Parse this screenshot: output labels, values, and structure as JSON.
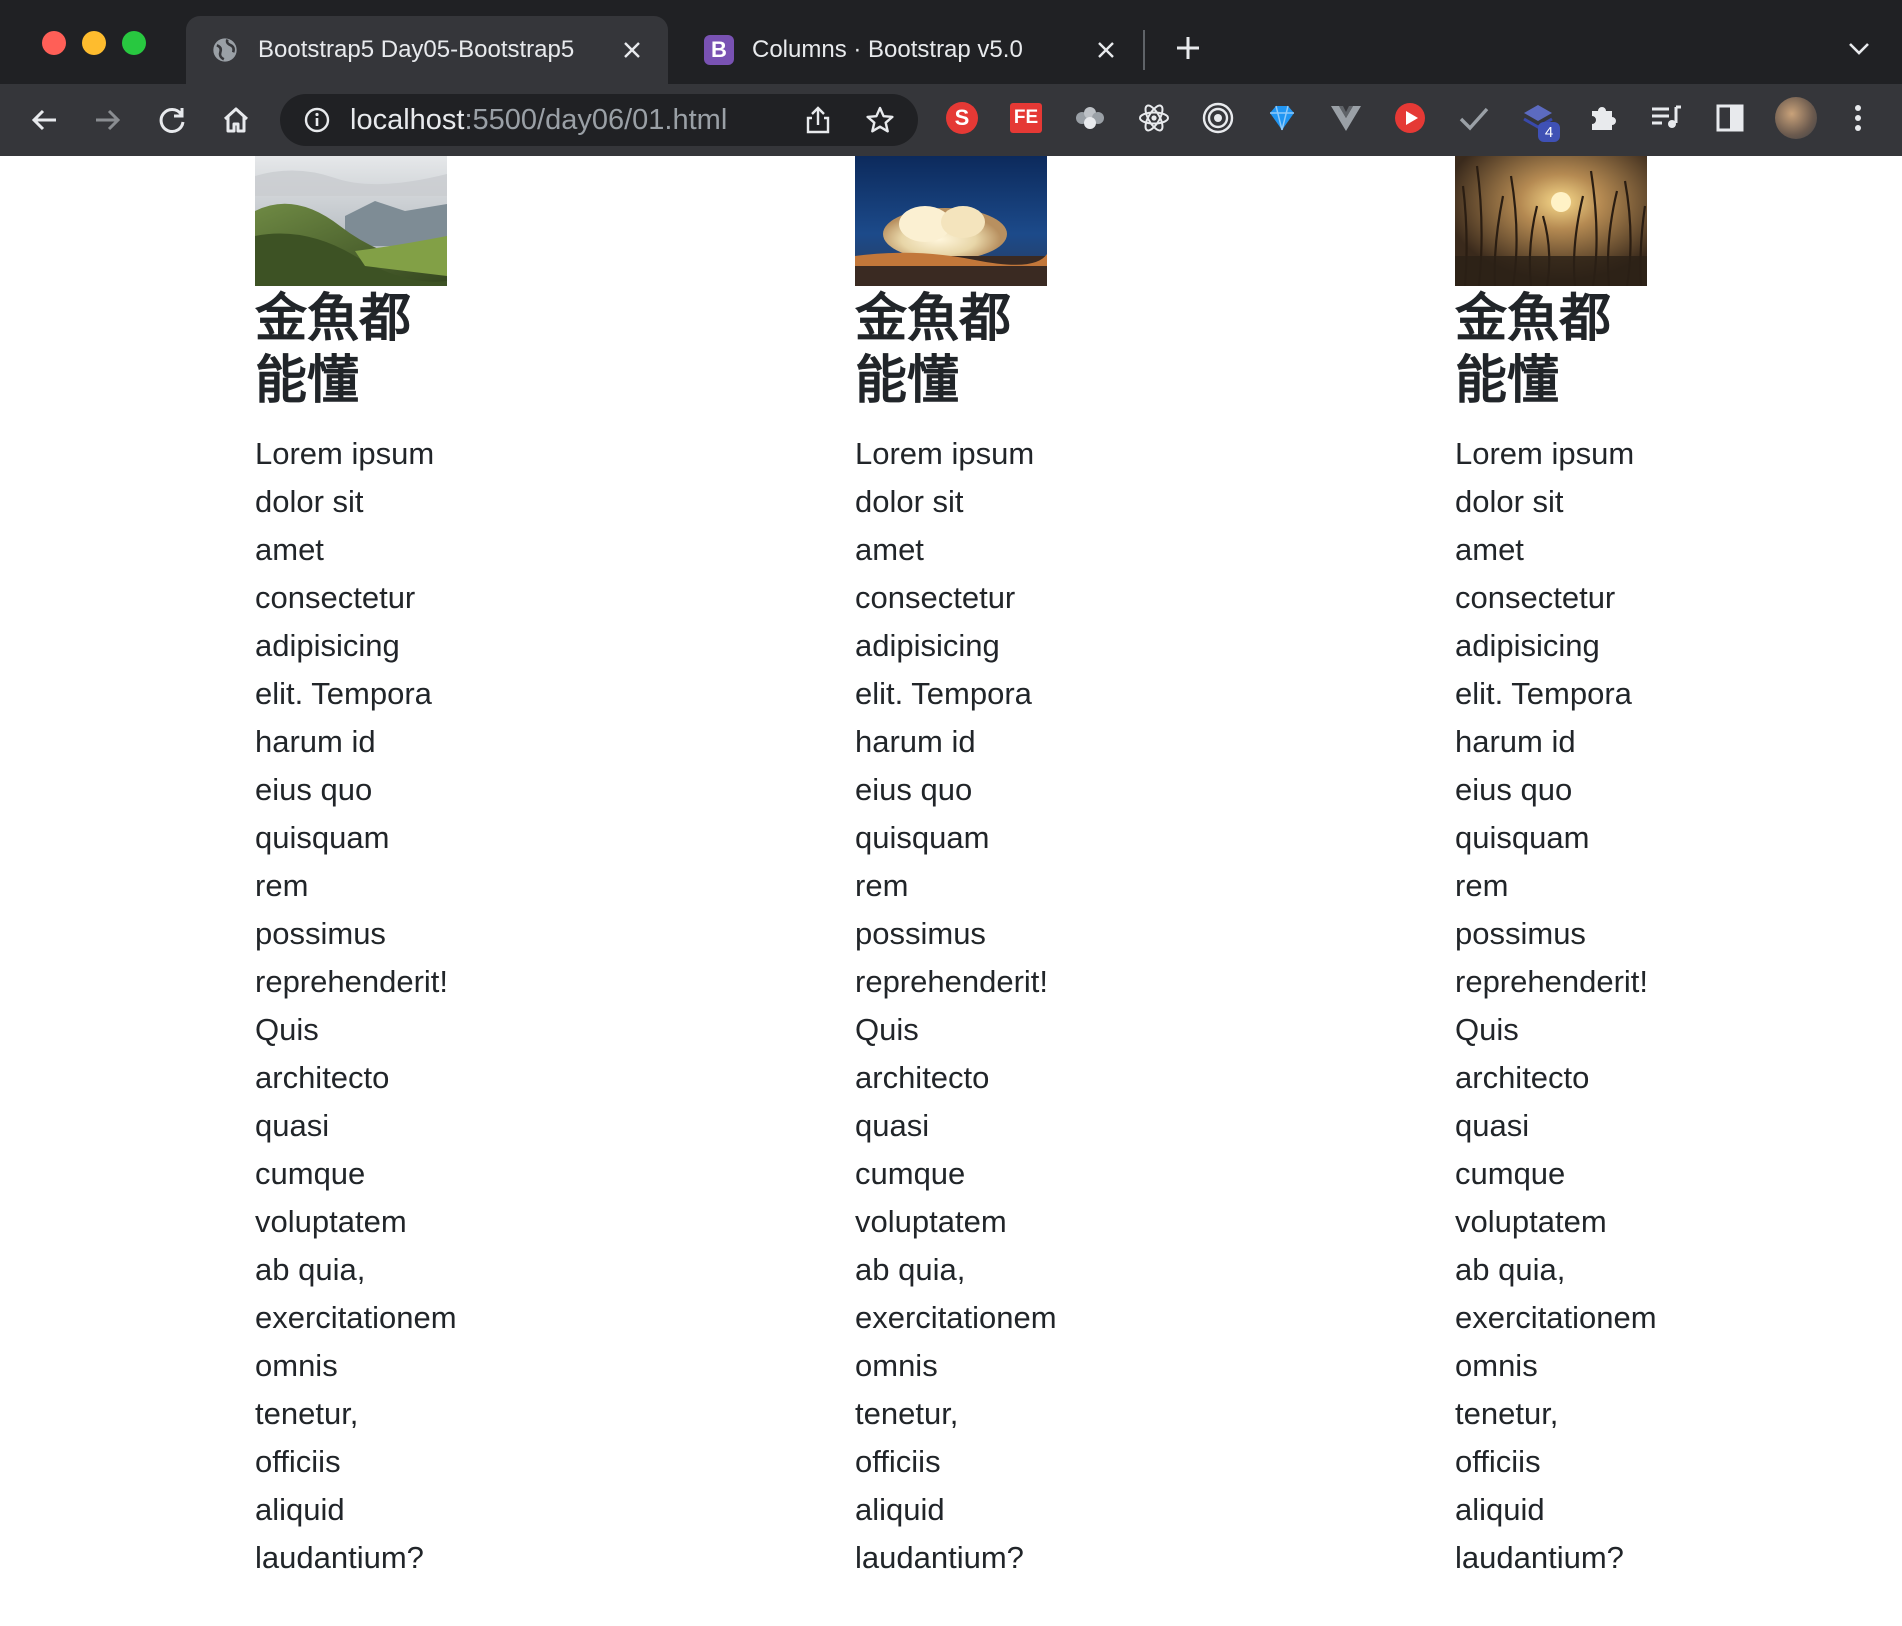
{
  "browser": {
    "tabs": [
      {
        "title": "Bootstrap5 Day05-Bootstrap5",
        "icon": "globe-icon",
        "active": true
      },
      {
        "title": "Columns · Bootstrap v5.0",
        "icon": "bootstrap-icon",
        "favicon_text": "B",
        "active": false
      }
    ],
    "address": {
      "host": "localhost",
      "rest": ":5500/day06/01.html"
    },
    "extensions": [
      {
        "name": "s-extension-icon",
        "label": "S"
      },
      {
        "name": "fe-extension-icon",
        "label": "FE"
      },
      {
        "name": "paw-extension-icon"
      },
      {
        "name": "react-devtools-icon"
      },
      {
        "name": "target-extension-icon"
      },
      {
        "name": "gem-extension-icon"
      },
      {
        "name": "vue-devtools-icon"
      },
      {
        "name": "play-extension-icon"
      },
      {
        "name": "check-extension-icon"
      },
      {
        "name": "layers-extension-icon",
        "badge": "4"
      },
      {
        "name": "puzzle-extensions-icon"
      },
      {
        "name": "media-playlist-icon"
      },
      {
        "name": "side-panel-icon"
      }
    ]
  },
  "columns": [
    {
      "image": "mountain-landscape-image",
      "heading": "金魚都能懂",
      "text": "Lorem ipsum\ndolor sit\namet\nconsectetur\nadipisicing\nelit. Tempora\nharum id\neius quo\nquisquam\nrem\npossimus\nreprehenderit!\nQuis\narchitecto\nquasi\ncumque\nvoluptatem\nab quia,\nexercitationem\nomnis\ntenetur,\nofficiis\naliquid\nlaudantium?"
    },
    {
      "image": "cloud-sky-image",
      "heading": "金魚都能懂",
      "text": "Lorem ipsum\ndolor sit\namet\nconsectetur\nadipisicing\nelit. Tempora\nharum id\neius quo\nquisquam\nrem\npossimus\nreprehenderit!\nQuis\narchitecto\nquasi\ncumque\nvoluptatem\nab quia,\nexercitationem\nomnis\ntenetur,\nofficiis\naliquid\nlaudantium?"
    },
    {
      "image": "sunset-grass-image",
      "heading": "金魚都能懂",
      "text": "Lorem ipsum\ndolor sit\namet\nconsectetur\nadipisicing\nelit. Tempora\nharum id\neius quo\nquisquam\nrem\npossimus\nreprehenderit!\nQuis\narchitecto\nquasi\ncumque\nvoluptatem\nab quia,\nexercitationem\nomnis\ntenetur,\nofficiis\naliquid\nlaudantium?"
    }
  ],
  "colors": {
    "tabbar": "#202124",
    "toolbar": "#35363a",
    "text": "#212529"
  }
}
